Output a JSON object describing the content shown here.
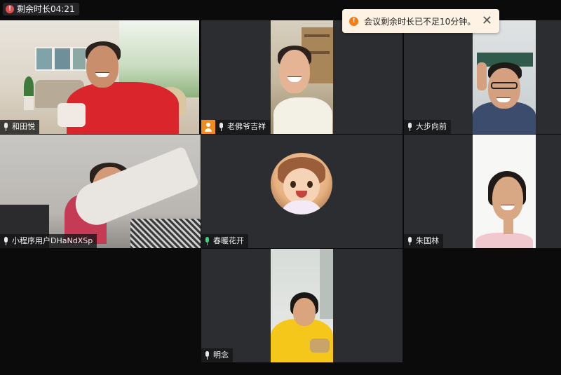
{
  "timer": {
    "text": "剩余时长04:21",
    "icon": "alert-icon"
  },
  "notification": {
    "message": "会议剩余时长已不足10分钟。",
    "close_label": "✕",
    "icon": "warning-icon"
  },
  "participants": [
    {
      "name": "和田悦",
      "mic": "muted",
      "active": false
    },
    {
      "name": "老佛爷吉祥",
      "mic": "muted",
      "host": true
    },
    {
      "name": "大步向前",
      "mic": "muted"
    },
    {
      "name": "小程序用户DHaNdXSp",
      "mic": "muted",
      "active": true
    },
    {
      "name": "春暖花开",
      "mic": "speaking",
      "avatar": true
    },
    {
      "name": "朱国林",
      "mic": "muted"
    },
    {
      "name": "明念",
      "mic": "muted"
    }
  ],
  "colors": {
    "background": "#0b0b0c",
    "tile_bg": "#2c2d31",
    "active_border": "#27c46a",
    "host_badge": "#f08c1c",
    "toast_bg": "#fdf2e4",
    "alert_red": "#e24c4c"
  }
}
